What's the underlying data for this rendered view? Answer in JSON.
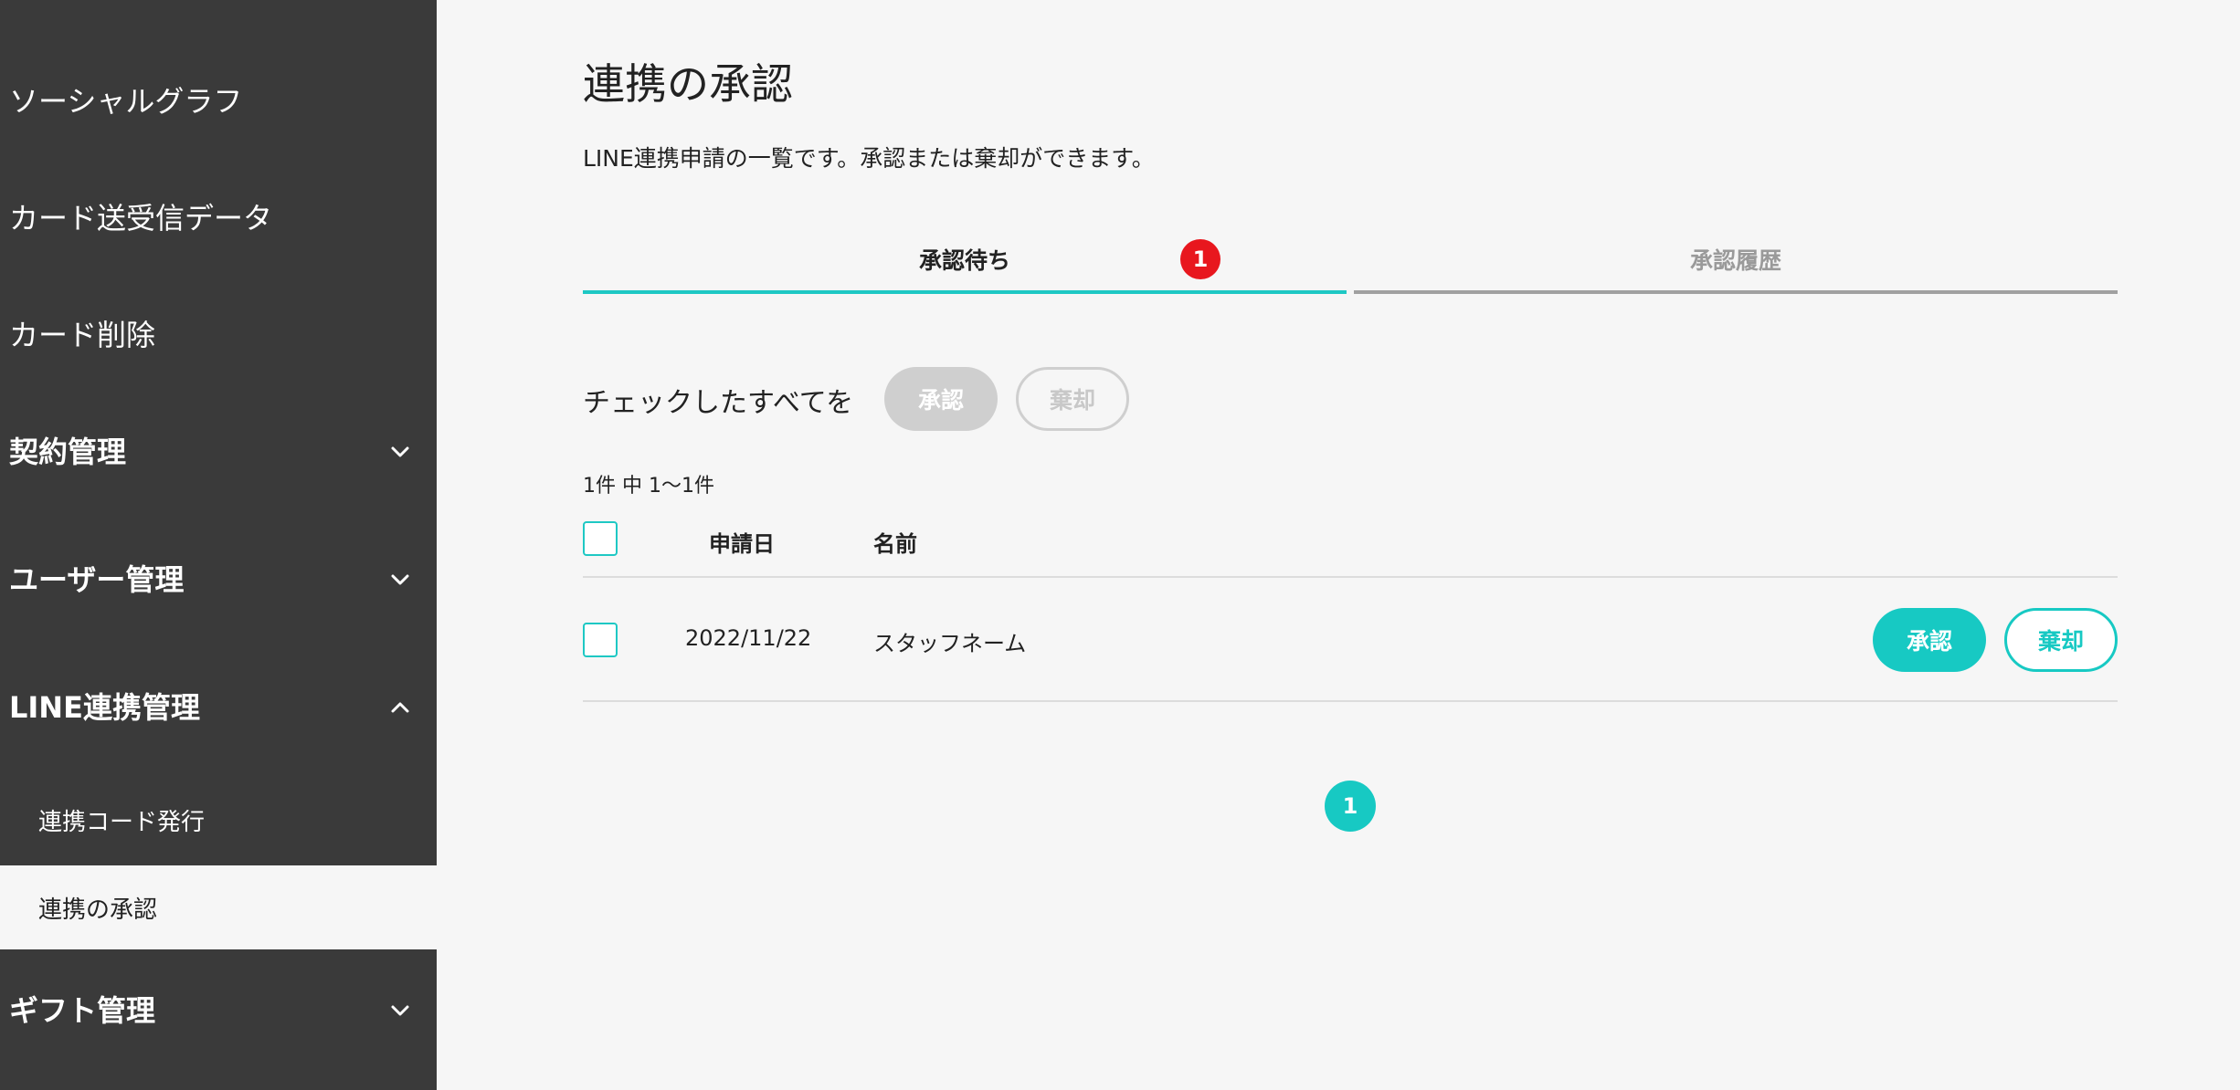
{
  "sidebar": {
    "items": [
      {
        "label": "ソーシャルグラフ"
      },
      {
        "label": "カード送受信データ"
      },
      {
        "label": "カード削除"
      },
      {
        "label": "契約管理"
      },
      {
        "label": "ユーザー管理"
      },
      {
        "label": "LINE連携管理"
      },
      {
        "label": "ギフト管理"
      }
    ],
    "sub_items": [
      {
        "label": "連携コード発行"
      },
      {
        "label": "連携の承認"
      }
    ]
  },
  "main": {
    "title": "連携の承認",
    "description": "LINE連携申請の一覧です。承認または棄却ができます。",
    "tabs": [
      {
        "label": "承認待ち",
        "badge": "1"
      },
      {
        "label": "承認履歴"
      }
    ],
    "bulk": {
      "label": "チェックしたすべてを",
      "approve_label": "承認",
      "reject_label": "棄却"
    },
    "result_count": "1件 中 1〜1件",
    "table": {
      "headers": {
        "date": "申請日",
        "name": "名前"
      },
      "rows": [
        {
          "date": "2022/11/22",
          "name": "スタッフネーム",
          "approve_label": "承認",
          "reject_label": "棄却"
        }
      ]
    },
    "pagination": {
      "current": "1"
    }
  },
  "colors": {
    "sidebar_bg": "#3a3a3a",
    "accent": "#17c9c3",
    "badge": "#e8171e",
    "background": "#f6f6f6"
  }
}
